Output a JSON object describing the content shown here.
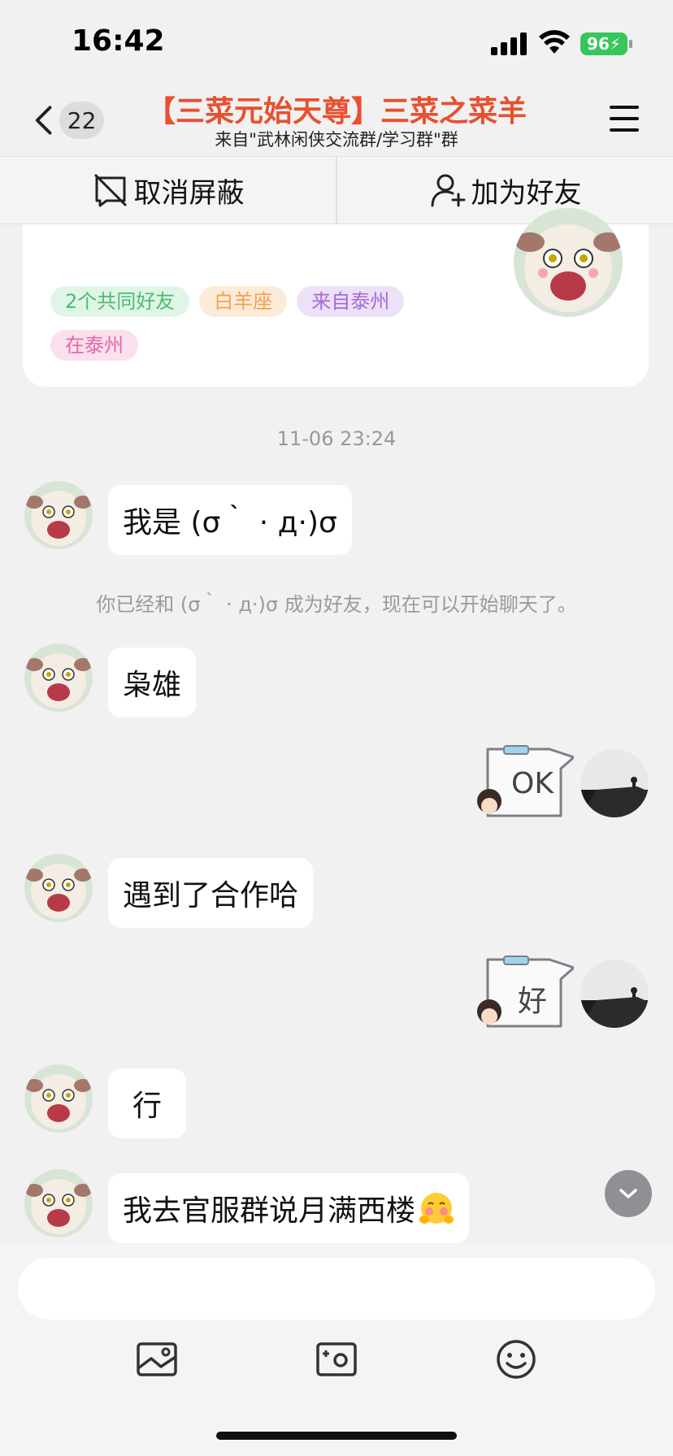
{
  "status_bar": {
    "time": "16:42",
    "battery": "96"
  },
  "nav": {
    "back_badge": "22",
    "title": "【三菜元始天尊】三菜之菜羊",
    "subtitle": "来自\"武林闲侠交流群/学习群\"群"
  },
  "actions": {
    "unblock": "取消屏蔽",
    "add_friend": "加为好友"
  },
  "profile": {
    "tags": [
      "2个共同好友",
      "白羊座",
      "来自泰州",
      "在泰州"
    ]
  },
  "chat": {
    "timestamp": "11-06 23:24",
    "system_notice": "你已经和 (σ｀ · д·)σ 成为好友，现在可以开始聊天了。",
    "messages": [
      {
        "side": "left",
        "type": "text",
        "text": "我是 (σ｀ · д·)σ"
      },
      {
        "side": "left",
        "type": "text",
        "text": "枭雄"
      },
      {
        "side": "right",
        "type": "sticker",
        "text": "OK"
      },
      {
        "side": "left",
        "type": "text",
        "text": "遇到了合作哈"
      },
      {
        "side": "right",
        "type": "sticker",
        "text": "好"
      },
      {
        "side": "left",
        "type": "text",
        "text": "行"
      },
      {
        "side": "left",
        "type": "text",
        "text": "我去官服群说月满西楼"
      }
    ]
  },
  "colors": {
    "title": "#e8502f",
    "background": "#f1f1f1",
    "bubble": "#ffffff"
  },
  "icons": [
    "back-chevron-icon",
    "menu-icon",
    "unblock-icon",
    "add-friend-icon",
    "photo-icon",
    "camera-icon",
    "emoji-icon",
    "scroll-down-icon"
  ]
}
